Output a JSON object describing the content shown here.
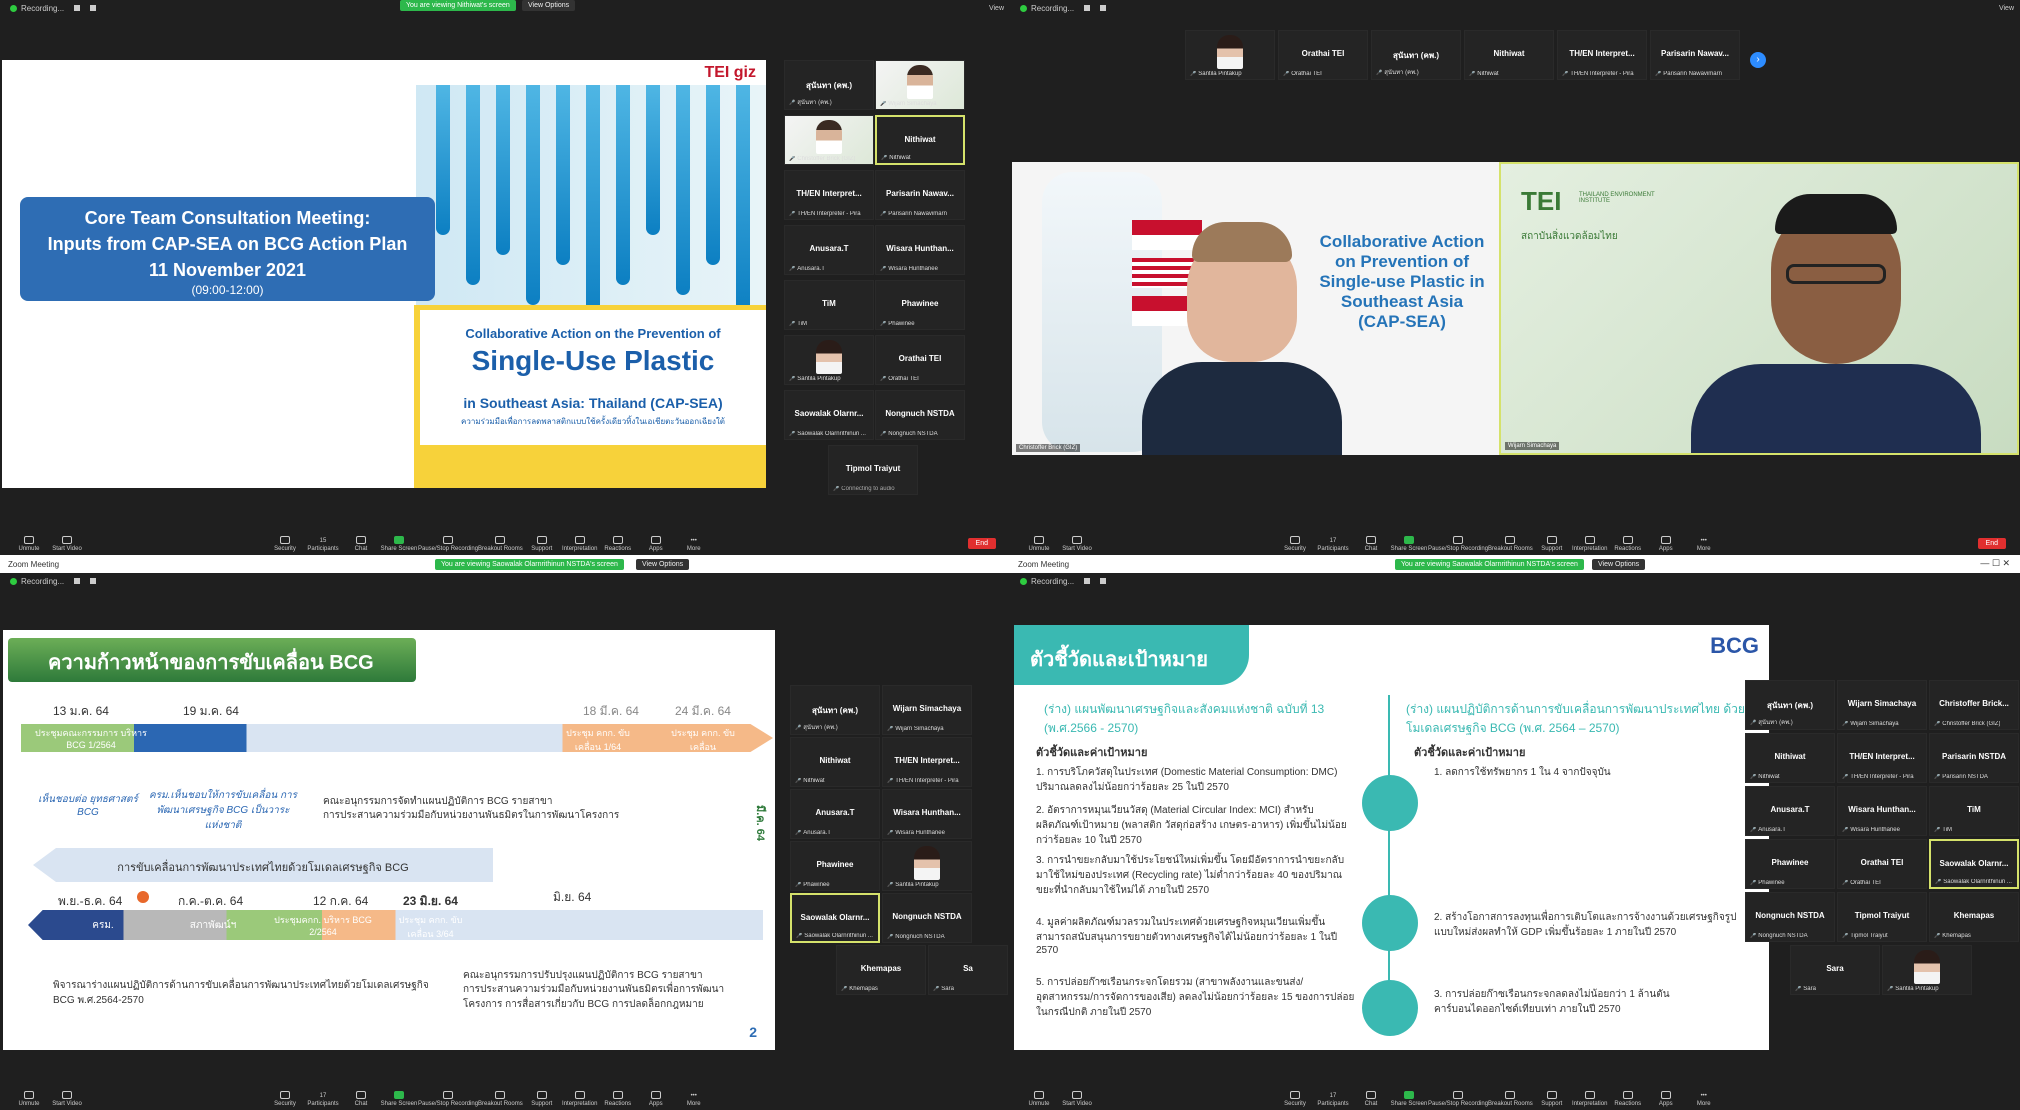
{
  "q1": {
    "recording": "Recording...",
    "viewing": "You are viewing Nithiwat's screen",
    "view_options": "View Options",
    "view": "View",
    "slide": {
      "logo": "TEI",
      "logo2": "giz",
      "title1": "Core Team Consultation Meeting:",
      "title2": "Inputs from CAP-SEA on BCG Action Plan",
      "date": "11 November 2021",
      "time": "(09:00-12:00)",
      "box_line1": "Collaborative Action on the Prevention of",
      "box_line2": "Single-Use Plastic",
      "box_line3": "in Southeast Asia: Thailand (CAP-SEA)",
      "box_line4": "ความร่วมมือเพื่อการลดพลาสติกแบบใช้ครั้งเดียวทิ้งในเอเชียตะวันออกเฉียงใต้"
    },
    "thumbs": [
      {
        "name": "สุนันทา (คพ.)",
        "label": "สุนันทา (คพ.)"
      },
      {
        "name": "",
        "label": "Wijarn Simachaya"
      },
      {
        "name": "",
        "label": "Christoffer Brick (GIZ)"
      },
      {
        "name": "Nithiwat",
        "label": "Nithiwat"
      },
      {
        "name": "TH/EN Interpret...",
        "label": "TH/EN Interpreter - Pira"
      },
      {
        "name": "Parisarin Nawav...",
        "label": "Parisarin Nawavimarn"
      },
      {
        "name": "Anusara.T",
        "label": "Anusara.T"
      },
      {
        "name": "Wisara Hunthan...",
        "label": "Wisara Hunthanee"
      },
      {
        "name": "TiM",
        "label": "TiM"
      },
      {
        "name": "Phawinee",
        "label": "Phawinee"
      },
      {
        "name": "",
        "label": "Santila Pintakup"
      },
      {
        "name": "Orathai TEI",
        "label": "Orathai TEI"
      },
      {
        "name": "Saowalak Olarnr...",
        "label": "Saowalak Olarnrithinun ..."
      },
      {
        "name": "Nongnuch NSTDA",
        "label": "Nongnuch NSTDA"
      },
      {
        "name": "Tipmol Traiyut",
        "label": "Connecting to audio"
      }
    ],
    "toolbar": {
      "unmute": "Unmute",
      "video": "Start Video",
      "security": "Security",
      "participants": "Participants",
      "participants_count": "15",
      "chat": "Chat",
      "share": "Share Screen",
      "pause": "Pause/Stop Recording",
      "breakout": "Breakout Rooms",
      "support": "Support",
      "interp": "Interpretation",
      "reactions": "Reactions",
      "apps": "Apps",
      "more": "More",
      "end": "End"
    }
  },
  "q2": {
    "recording": "Recording...",
    "view": "View",
    "top_thumbs": [
      {
        "name": "",
        "label": "Santila Pintakup"
      },
      {
        "name": "Orathai TEI",
        "label": "Orathai TEI"
      },
      {
        "name": "สุนันทา (คพ.)",
        "label": "สุนันทา (คพ.)"
      },
      {
        "name": "Nithiwat",
        "label": "Nithiwat"
      },
      {
        "name": "TH/EN Interpret...",
        "label": "TH/EN Interpreter - Pira"
      },
      {
        "name": "Parisarin Nawav...",
        "label": "Parisarin Nawavimarn"
      }
    ],
    "tile1_name": "Christoffer Brick (GIZ)",
    "tile2_name": "Wijarn Simachaya",
    "cap_text": [
      "Collaborative Action",
      "on Prevention of",
      "Single-use Plastic in",
      "Southeast Asia",
      "(CAP-SEA)"
    ],
    "tei_logo": "TEI",
    "tei_sub": "THAILAND ENVIRONMENT INSTITUTE",
    "tei_thai": "สถาบันสิ่งแวดล้อมไทย",
    "toolbar": {
      "unmute": "Unmute",
      "video": "Start Video",
      "security": "Security",
      "participants": "Participants",
      "participants_count": "17",
      "chat": "Chat",
      "share": "Share Screen",
      "pause": "Pause/Stop Recording",
      "breakout": "Breakout Rooms",
      "support": "Support",
      "interp": "Interpretation",
      "reactions": "Reactions",
      "apps": "Apps",
      "more": "More",
      "end": "End"
    }
  },
  "q3": {
    "window_title": "Zoom Meeting",
    "recording": "Recording...",
    "viewing": "You are viewing Saowalak Olarnrithinun NSTDA's screen",
    "view_options": "View Options",
    "slide": {
      "title": "ความก้าวหน้าของการขับเคลื่อน BCG",
      "d1": "13 ม.ค. 64",
      "d2": "19 ม.ค. 64",
      "d3": "18 มี.ค. 64",
      "d4": "24 มี.ค. 64",
      "a1": "ประชุมคณะกรรมการ บริหาร BCG 1/2564",
      "a2": "ประชุม คกก. ขับเคลื่อน 1/64",
      "a3": "ประชุม คกก. ขับเคลื่อน",
      "n1": "เห็นชอบต่อ ยุทธศาสตร์ BCG",
      "n2": "ครม.เห็นชอบให้การขับเคลื่อน การพัฒนาเศรษฐกิจ BCG เป็นวาระแห่งชาติ",
      "b1": "คณะอนุกรรมการจัดทำแผนปฏิบัติการ BCG รายสาขา",
      "b2": "การประสานความร่วมมือกับหน่วยงานพันธมิตรในการพัฒนาโครงการ",
      "banner": "การขับเคลื่อนการพัฒนาประเทศไทยด้วยโมเดลเศรษฐกิจ BCG",
      "side": "มี.ค. 64",
      "e1": "พ.ย.-ธ.ค. 64",
      "e2": "ก.ค.-ต.ค. 64",
      "e3": "12 ก.ค. 64",
      "e4": "23 มิ.ย. 64",
      "e5": "มิ.ย. 64",
      "f1": "ครม.",
      "f2": "สภาพัฒน์ฯ",
      "f3": "ประชุมคกก. บริหาร BCG 2/2564",
      "f4": "ประชุม คกก. ขับเคลื่อน 3/64",
      "g1": "พิจารณาร่างแผนปฏิบัติการด้านการขับเคลื่อนการพัฒนาประเทศไทยด้วยโมเดลเศรษฐกิจ BCG พ.ศ.2564-2570",
      "g2": "คณะอนุกรรมการปรับปรุงแผนปฏิบัติการ BCG รายสาขา",
      "g3": "การประสานความร่วมมือกับหน่วยงานพันธมิตรเพื่อการพัฒนาโครงการ การสื่อสารเกี่ยวกับ BCG การปลดล็อกกฎหมาย",
      "page": "2"
    },
    "thumbs": [
      {
        "name": "สุนันทา (คพ.)",
        "label": "สุนันทา (คพ.)"
      },
      {
        "name": "Wijarn Simachaya",
        "label": "Wijarn Simachaya"
      },
      {
        "name": "Nithiwat",
        "label": "Nithiwat"
      },
      {
        "name": "TH/EN Interpret...",
        "label": "TH/EN Interpreter - Pira"
      },
      {
        "name": "Anusara.T",
        "label": "Anusara.T"
      },
      {
        "name": "Wisara Hunthan...",
        "label": "Wisara Hunthanee"
      },
      {
        "name": "Phawinee",
        "label": "Phawinee"
      },
      {
        "name": "",
        "label": "Santila Pintakup"
      },
      {
        "name": "Saowalak Olarnr...",
        "label": "Saowalak Olarnrithinun ..."
      },
      {
        "name": "Nongnuch NSTDA",
        "label": "Nongnuch NSTDA"
      },
      {
        "name": "Khemapas",
        "label": "Khemapas"
      },
      {
        "name": "Sa",
        "label": "Sara"
      }
    ],
    "toolbar": {
      "unmute": "Unmute",
      "video": "Start Video",
      "security": "Security",
      "participants": "Participants",
      "participants_count": "17",
      "chat": "Chat",
      "share": "Share Screen",
      "pause": "Pause/Stop Recording",
      "breakout": "Breakout Rooms",
      "support": "Support",
      "interp": "Interpretation",
      "reactions": "Reactions",
      "apps": "Apps",
      "more": "More"
    }
  },
  "q4": {
    "window_title": "Zoom Meeting",
    "recording": "Recording...",
    "viewing": "You are viewing Saowalak Olarnrithinun NSTDA's screen",
    "view_options": "View Options",
    "slide": {
      "title": "ตัวชี้วัดและเป้าหมาย",
      "bcg": "BCG",
      "left_head": "(ร่าง) แผนพัฒนาเศรษฐกิจและสังคมแห่งชาติ ฉบับที่ 13 (พ.ศ.2566 - 2570)",
      "right_head": "(ร่าง) แผนปฏิบัติการด้านการขับเคลื่อนการพัฒนาประเทศไทย ด้วยโมเดลเศรษฐกิจ BCG (พ.ศ. 2564 – 2570)",
      "sub": "ตัวชี้วัดและค่าเป้าหมาย",
      "l1": "1. การบริโภควัสดุในประเทศ (Domestic Material Consumption: DMC) ปริมาณลดลงไม่น้อยกว่าร้อยละ 25 ในปี 2570",
      "l2": "2. อัตราการหมุนเวียนวัสดุ (Material Circular Index: MCI) สำหรับผลิตภัณฑ์เป้าหมาย (พลาสติก วัสดุก่อสร้าง เกษตร-อาหาร) เพิ่มขึ้นไม่น้อยกว่าร้อยละ 10 ในปี 2570",
      "l3": "3. การนำขยะกลับมาใช้ประโยชน์ใหม่เพิ่มขึ้น โดยมีอัตราการนำขยะกลับมาใช้ใหม่ของประเทศ (Recycling rate) ไม่ต่ำกว่าร้อยละ 40 ของปริมาณขยะที่นำกลับมาใช้ใหม่ได้ ภายในปี 2570",
      "l4": "4. มูลค่าผลิตภัณฑ์มวลรวมในประเทศด้วยเศรษฐกิจหมุนเวียนเพิ่มขึ้น สามารถสนับสนุนการขยายตัวทางเศรษฐกิจได้ไม่น้อยกว่าร้อยละ 1 ในปี 2570",
      "l5": "5. การปล่อยก๊าซเรือนกระจกโดยรวม (สาขาพลังงานและขนส่ง/อุตสาหกรรม/การจัดการของเสีย) ลดลงไม่น้อยกว่าร้อยละ 15 ของการปล่อยในกรณีปกติ ภายในปี 2570",
      "r1": "1. ลดการใช้ทรัพยากร 1 ใน 4 จากปัจจุบัน",
      "r2": "2. สร้างโอกาสการลงทุนเพื่อการเติบโตและการจ้างงานด้วยเศรษฐกิจรูปแบบใหม่ส่งผลทำให้ GDP เพิ่มขึ้นร้อยละ 1 ภายในปี 2570",
      "r3": "3. การปล่อยก๊าซเรือนกระจกลดลงไม่น้อยกว่า 1 ล้านตันคาร์บอนไดออกไซด์เทียบเท่า ภายในปี 2570"
    },
    "thumbs": [
      {
        "name": "สุนันทา (คพ.)",
        "label": "สุนันทา (คพ.)"
      },
      {
        "name": "Wijarn Simachaya",
        "label": "Wijarn Simachaya"
      },
      {
        "name": "Christoffer Brick...",
        "label": "Christoffer Brick (GIZ)"
      },
      {
        "name": "Nithiwat",
        "label": "Nithiwat"
      },
      {
        "name": "TH/EN Interpret...",
        "label": "TH/EN Interpreter - Pira"
      },
      {
        "name": "Parisarin NSTDA",
        "label": "Parisarin NSTDA"
      },
      {
        "name": "Anusara.T",
        "label": "Anusara.T"
      },
      {
        "name": "Wisara Hunthan...",
        "label": "Wisara Hunthanee"
      },
      {
        "name": "TiM",
        "label": "TiM"
      },
      {
        "name": "Phawinee",
        "label": "Phawinee"
      },
      {
        "name": "Orathai TEI",
        "label": "Orathai TEI"
      },
      {
        "name": "Saowalak Olarnr...",
        "label": "Saowalak Olarnrithinun ..."
      },
      {
        "name": "Nongnuch NSTDA",
        "label": "Nongnuch NSTDA"
      },
      {
        "name": "Tipmol Traiyut",
        "label": "Tipmol Traiyut"
      },
      {
        "name": "Khemapas",
        "label": "Khemapas"
      },
      {
        "name": "Sara",
        "label": "Sara"
      },
      {
        "name": "",
        "label": "Santila Pintakup"
      }
    ],
    "toolbar": {
      "unmute": "Unmute",
      "video": "Start Video",
      "security": "Security",
      "participants": "Participants",
      "participants_count": "17",
      "chat": "Chat",
      "share": "Share Screen",
      "pause": "Pause/Stop Recording",
      "breakout": "Breakout Rooms",
      "support": "Support",
      "interp": "Interpretation",
      "reactions": "Reactions",
      "apps": "Apps",
      "more": "More"
    }
  }
}
